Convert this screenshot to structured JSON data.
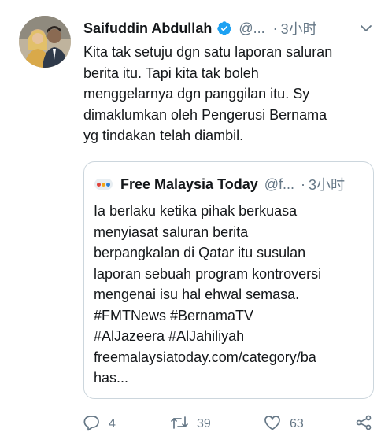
{
  "tweet": {
    "author_name": "Saifuddin Abdullah",
    "handle": "@...",
    "separator": "·",
    "time": "3小时",
    "text": "Kita tak setuju dgn satu laporan saluran\nberita itu. Tapi kita tak boleh\nmenggelarnya dgn panggilan itu. Sy\ndimaklumkan oleh Pengerusi Bernama\nyg tindakan telah diambil.",
    "verified_color": "#1da1f2"
  },
  "quoted": {
    "author_name": "Free Malaysia Today",
    "handle": "@f...",
    "separator": "·",
    "time": "3小时",
    "text": "Ia berlaku ketika pihak berkuasa\nmenyiasat saluran berita\nberpangkalan di Qatar itu susulan\nlaporan sebuah program kontroversi\nmengenai isu hal ehwal semasa.\n#FMTNews #BernamaTV\n#AlJazeera #AlJahiliyah\nfreemalaysiatoday.com/category/ba\nhas..."
  },
  "actions": {
    "reply_count": "4",
    "retweet_count": "39",
    "like_count": "63"
  },
  "icons": [
    "verified-badge-icon",
    "chevron-down-icon",
    "reply-icon",
    "retweet-icon",
    "like-icon",
    "share-icon",
    "fmt-logo"
  ]
}
